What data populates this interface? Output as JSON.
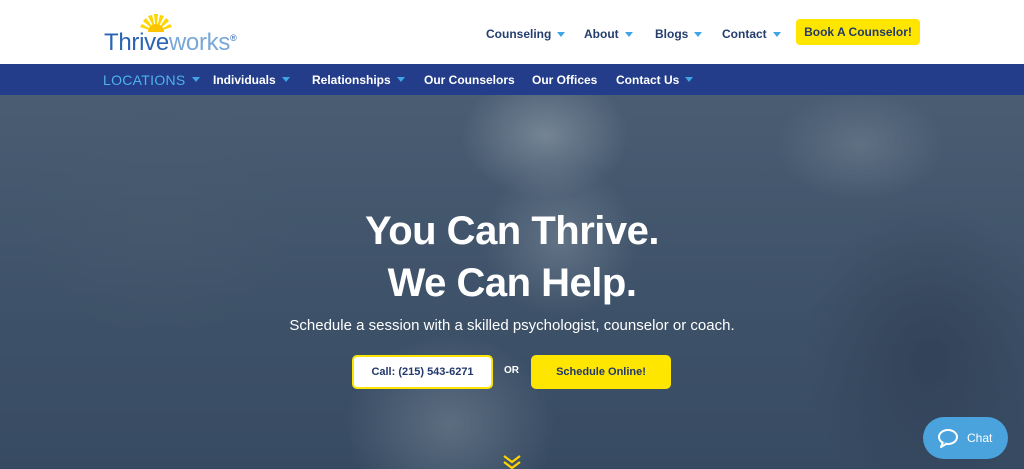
{
  "header": {
    "logo": {
      "text_primary": "Thrive",
      "text_secondary": "works",
      "registered": "®"
    },
    "nav": [
      {
        "label": "Counseling"
      },
      {
        "label": "About"
      },
      {
        "label": "Blogs"
      },
      {
        "label": "Contact"
      }
    ],
    "book_button": "Book A Counselor!"
  },
  "subnav": {
    "items": [
      {
        "label": "LOCATIONS",
        "active": true,
        "dropdown": true
      },
      {
        "label": "Individuals",
        "dropdown": true
      },
      {
        "label": "Relationships",
        "dropdown": true
      },
      {
        "label": "Our Counselors",
        "dropdown": false
      },
      {
        "label": "Our Offices",
        "dropdown": false
      },
      {
        "label": "Contact Us",
        "dropdown": true
      }
    ]
  },
  "hero": {
    "title_line1": "You Can Thrive.",
    "title_line2": "We Can Help.",
    "subtitle": "Schedule a session with a skilled psychologist, counselor or coach.",
    "call_button": "Call: (215) 543-6271",
    "or_text": "OR",
    "schedule_button": "Schedule Online!"
  },
  "chat": {
    "label": "Chat"
  },
  "icons": {
    "logo_sun": "sunburst-icon",
    "dropdown": "caret-down-icon",
    "scroll": "double-chevron-down-icon",
    "chat": "chat-bubble-icon"
  },
  "colors": {
    "brand_blue": "#2c63b4",
    "nav_bar": "#233d8a",
    "active_link": "#4fb2ec",
    "accent_yellow": "#ffe600",
    "chat_blue": "#4aa3dc"
  }
}
